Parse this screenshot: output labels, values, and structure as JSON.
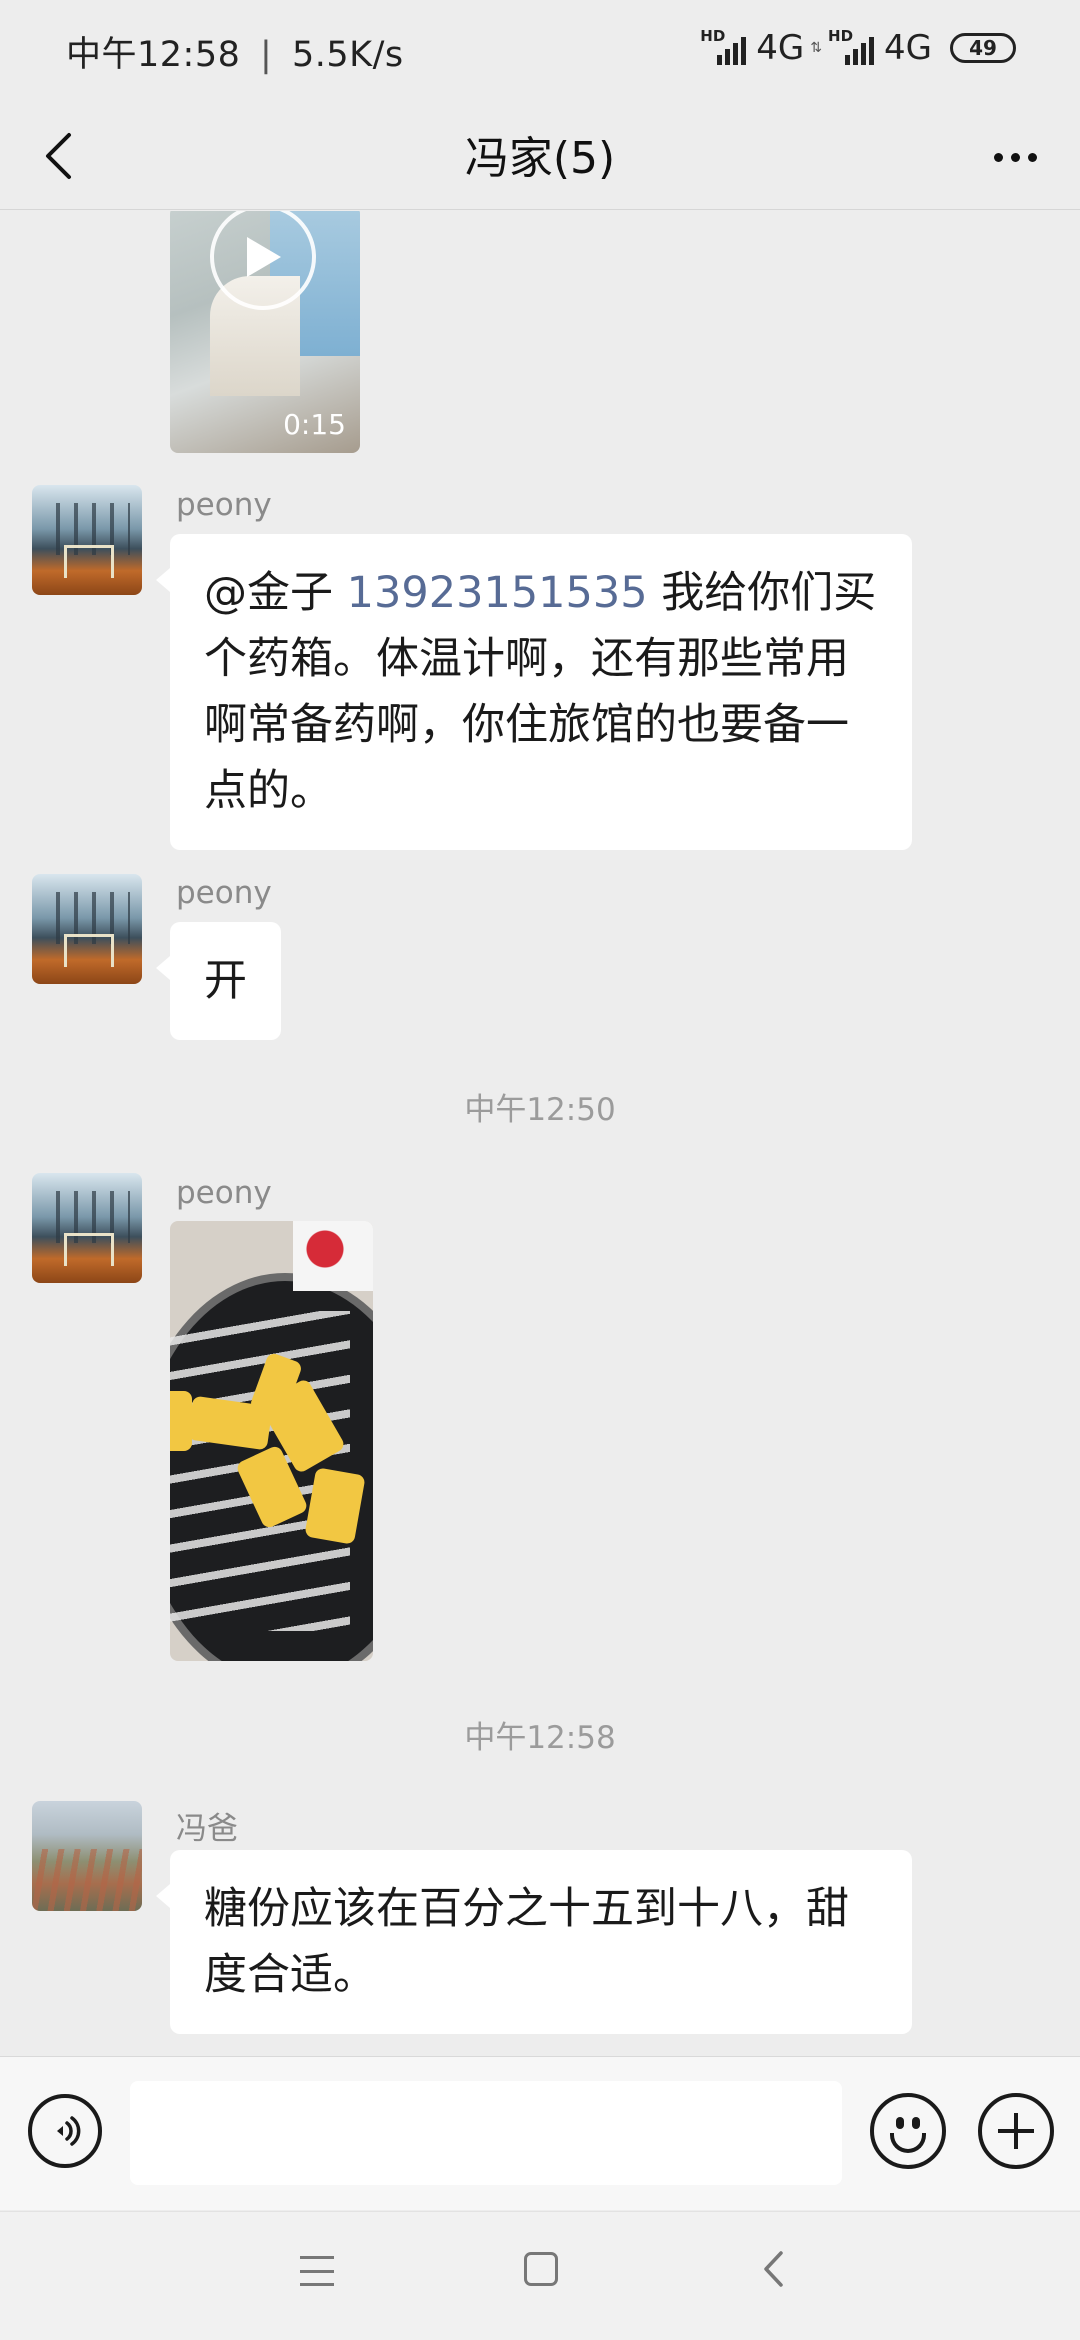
{
  "status_bar": {
    "time": "中午12:58",
    "separator": "|",
    "net_speed": "5.5K/s",
    "sim1_badge": "HD",
    "sim1_network": "4G",
    "sim2_badge": "HD",
    "sim2_network": "4G",
    "battery": "49"
  },
  "header": {
    "title": "冯家(5)",
    "back_icon": "chevron-left-icon",
    "more_icon": "more-dots-icon"
  },
  "chat": {
    "video": {
      "duration": "0:15"
    },
    "messages": [
      {
        "sender": "peony",
        "text_before": "@金子 ",
        "mention_number": "13923151535",
        "text_after": " 我给你们买个药箱。体温计啊，还有那些常用啊常备药啊，你住旅馆的也要备一点的。"
      },
      {
        "sender": "peony",
        "text": "开"
      },
      {
        "sender": "peony",
        "type": "image"
      },
      {
        "sender": "冯爸",
        "text": "糖份应该在百分之十五到十八，甜度合适。"
      }
    ],
    "time_separators": [
      "中午12:50",
      "中午12:58"
    ]
  },
  "input_bar": {
    "placeholder": "",
    "voice_icon": "voice-icon",
    "emoji_icon": "emoji-icon",
    "plus_icon": "plus-icon"
  },
  "nav_bar": {
    "menu_icon": "menu-icon",
    "home_icon": "home-icon",
    "back_icon": "back-icon"
  }
}
